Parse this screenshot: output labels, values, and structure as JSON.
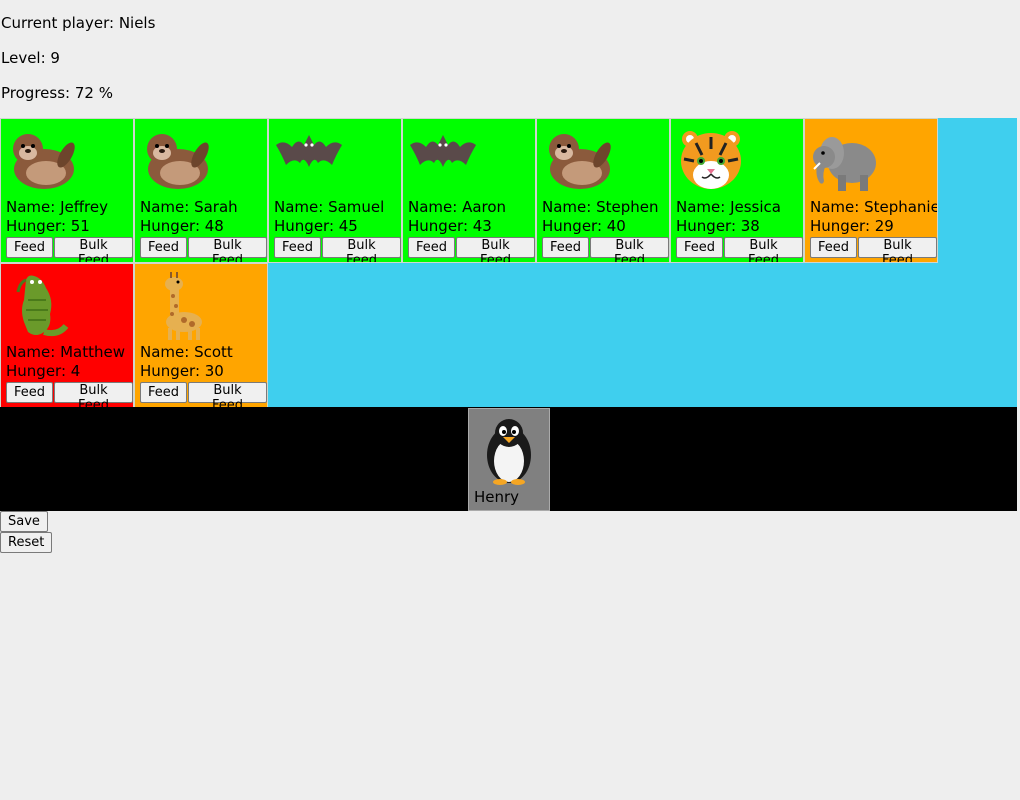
{
  "status": {
    "player_text": "Current player: Niels",
    "level_text": "Level: 9",
    "progress_text": "Progress: 72 %"
  },
  "buttons": {
    "feed": "Feed",
    "bulk_feed": "Bulk Feed",
    "save": "Save",
    "reset": "Reset"
  },
  "colors": {
    "healthy": "#00ff00",
    "warning": "#ffa500",
    "danger": "#ff0000",
    "zoo_background": "#3fcfee",
    "pen_background": "#000000",
    "pen_card": "#808080"
  },
  "animals": [
    {
      "icon": "otter-icon",
      "name": "Name: Jeffrey",
      "hunger": "Hunger: 51",
      "status": "healthy"
    },
    {
      "icon": "otter-icon",
      "name": "Name: Sarah",
      "hunger": "Hunger: 48",
      "status": "healthy"
    },
    {
      "icon": "bat-icon",
      "name": "Name: Samuel",
      "hunger": "Hunger: 45",
      "status": "healthy"
    },
    {
      "icon": "bat-icon",
      "name": "Name: Aaron",
      "hunger": "Hunger: 43",
      "status": "healthy"
    },
    {
      "icon": "otter-icon",
      "name": "Name: Stephen",
      "hunger": "Hunger: 40",
      "status": "healthy"
    },
    {
      "icon": "tiger-icon",
      "name": "Name: Jessica",
      "hunger": "Hunger: 38",
      "status": "healthy"
    },
    {
      "icon": "elephant-icon",
      "name": "Name: Stephanie",
      "hunger": "Hunger: 29",
      "status": "warning"
    },
    {
      "icon": "crocodile-icon",
      "name": "Name: Matthew",
      "hunger": "Hunger: 4",
      "status": "danger"
    },
    {
      "icon": "giraffe-icon",
      "name": "Name: Scott",
      "hunger": "Hunger: 30",
      "status": "warning"
    }
  ],
  "pen": {
    "icon": "penguin-icon",
    "name": "Henry"
  }
}
